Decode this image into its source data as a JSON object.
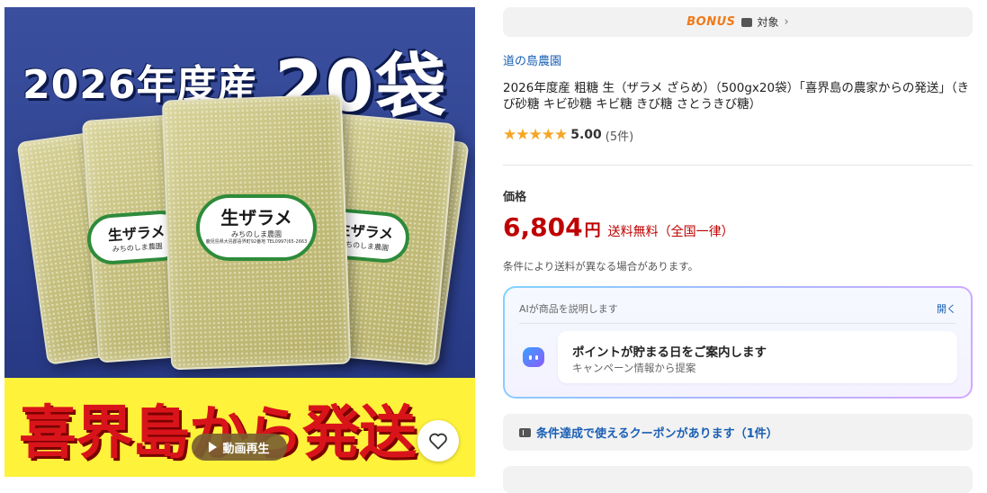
{
  "image": {
    "title_prefix": "2026年度産",
    "title_count": "20袋",
    "label_main": "生ザラメ",
    "label_sub": "みちのしま農園",
    "label_fine": "鹿児島県大島郡喜界町92番地 TEL0997(65-2663",
    "banner": "喜界島から発送",
    "video_button": "動画再生"
  },
  "bonus": {
    "logo": "BONUS",
    "target": "対象",
    "chevron": "›"
  },
  "store": {
    "name": "道の島農園"
  },
  "product": {
    "title": "2026年度産 粗糖 生（ザラメ ざらめ）（500gx20袋）「喜界島の農家からの発送」（きび砂糖 キビ砂糖 キビ糖 きび糖 さとうきび糖）"
  },
  "rating": {
    "stars": "★★★★★",
    "score": "5.00",
    "count": "(5件)"
  },
  "price": {
    "label": "価格",
    "value": "6,804",
    "currency": "円",
    "shipping": "送料無料（全国一律）",
    "note": "条件により送料が異なる場合があります。"
  },
  "ai": {
    "header": "AIが商品を説明します",
    "open": "開く",
    "bubble_title": "ポイントが貯まる日をご案内します",
    "bubble_sub": "キャンペーン情報から提案"
  },
  "coupon": {
    "text": "条件達成で使えるクーポンがあります（1件）"
  },
  "colors": {
    "price_red": "#bf0000",
    "link_blue": "#1a5fb4",
    "star_gold": "#f5a623",
    "bonus_orange": "#f07a1a"
  }
}
